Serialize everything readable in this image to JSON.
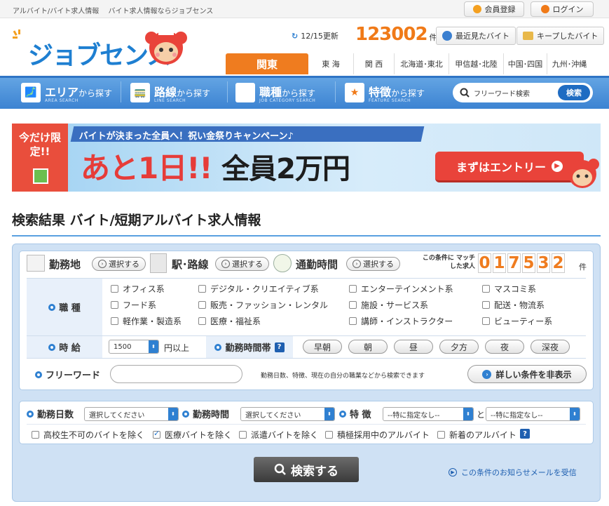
{
  "topbar": {
    "text": "アルバイト/バイト求人情報　 バイト求人情報ならジョブセンス",
    "register": "会員登録",
    "login": "ログイン"
  },
  "header": {
    "logo": "ジョブセンス",
    "update": "12/15更新",
    "count": "123002",
    "count_unit": "件",
    "recent": "最近見たバイト",
    "kept": "キープしたバイト"
  },
  "regions": [
    "関東",
    "東 海",
    "関 西",
    "北海道･東北",
    "甲信越･北陸",
    "中国･四国",
    "九州･沖縄"
  ],
  "nav": [
    {
      "main": "エリア",
      "suffix": "から探す",
      "sub": "AREA SEARCH"
    },
    {
      "main": "路線",
      "suffix": "から探す",
      "sub": "LINE SEARCH"
    },
    {
      "main": "職種",
      "suffix": "から探す",
      "sub": "JOB CATEGORY SEARCH"
    },
    {
      "main": "特徴",
      "suffix": "から探す",
      "sub": "FEATURE SEARCH"
    }
  ],
  "search": {
    "placeholder": "フリーワード検索",
    "button": "検索"
  },
  "banner": {
    "limited": "今だけ限定!!",
    "headline": "バイトが決まった全員へ！祝い金祭りキャンペーン♪",
    "big1": "あと1日!!",
    "big2": "全員2万円",
    "entry": "まずはエントリー"
  },
  "heading": "検索結果 バイト/短期アルバイト求人情報",
  "form": {
    "area": "勤務地",
    "line": "駅･路線",
    "commute": "通勤時間",
    "select": "選択する",
    "match_label": "この条件に マッチした求人",
    "match_digits": [
      "0",
      "1",
      "7",
      "5",
      "3",
      "2"
    ],
    "match_unit": "件",
    "job_label": "職 種",
    "jobs": [
      "オフィス系",
      "デジタル・クリエイティブ系",
      "エンターテインメント系",
      "マスコミ系",
      "フード系",
      "販売・ファッション・レンタル",
      "施設・サービス系",
      "配送・物流系",
      "軽作業・製造系",
      "医療・福祉系",
      "講師・インストラクター",
      "ビューティー系"
    ],
    "wage_label": "時 給",
    "wage_value": "1500",
    "wage_suffix": "円以上",
    "timeband_label": "勤務時間帯",
    "timebands": [
      "早朝",
      "朝",
      "昼",
      "夕方",
      "夜",
      "深夜"
    ],
    "freeword_label": "フリーワード",
    "freeword_note": "勤務日数、特徴、現在の自分の職業などから検索できます",
    "hide_button": "詳しい条件を非表示",
    "days_label": "勤務日数",
    "hours_label": "勤務時間",
    "feature_label": "特 徴",
    "days_value": "選択してください",
    "hours_value": "選択してください",
    "feature_value1": "--特に指定なし--",
    "feature_and": "と",
    "feature_value2": "--特に指定なし--",
    "excludes": [
      {
        "label": "高校生不可のバイトを除く",
        "checked": false
      },
      {
        "label": "医療バイトを除く",
        "checked": true
      },
      {
        "label": "派遣バイトを除く",
        "checked": false
      },
      {
        "label": "積極採用中のアルバイト",
        "checked": false
      },
      {
        "label": "新着のアルバイト",
        "checked": false
      }
    ],
    "search_button": "検索する",
    "notify": "この条件のお知らせメールを受信"
  },
  "colors": {
    "orange": "#ef7c1f",
    "blue": "#2f80d1",
    "red": "#e9433a"
  }
}
